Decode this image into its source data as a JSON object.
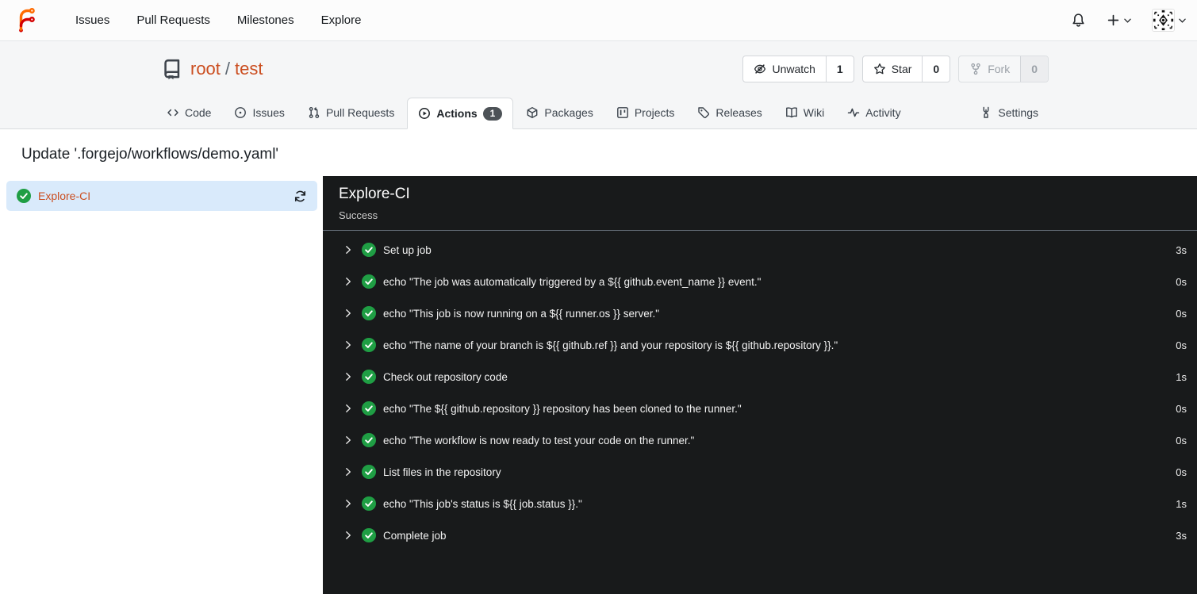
{
  "navbar": {
    "links": [
      "Issues",
      "Pull Requests",
      "Milestones",
      "Explore"
    ],
    "icons": [
      "forgejo-logo",
      "bell-icon",
      "plus-icon",
      "avatar-identicon"
    ]
  },
  "repo_header": {
    "icon": "repo-book-icon",
    "owner": "root",
    "separator": "/",
    "name": "test",
    "buttons": [
      {
        "label": "Unwatch",
        "count": "1",
        "icon": "eye-slash-icon",
        "disabled": false
      },
      {
        "label": "Star",
        "count": "0",
        "icon": "star-icon",
        "disabled": false
      },
      {
        "label": "Fork",
        "count": "0",
        "icon": "git-fork-icon",
        "disabled": true
      }
    ]
  },
  "tabs": [
    {
      "label": "Code",
      "icon": "code-icon"
    },
    {
      "label": "Issues",
      "icon": "issue-circle-icon"
    },
    {
      "label": "Pull Requests",
      "icon": "pull-request-icon"
    },
    {
      "label": "Actions",
      "icon": "play-circle-icon",
      "badge": "1",
      "active": true
    },
    {
      "label": "Packages",
      "icon": "package-icon"
    },
    {
      "label": "Projects",
      "icon": "project-board-icon"
    },
    {
      "label": "Releases",
      "icon": "tag-icon"
    },
    {
      "label": "Wiki",
      "icon": "book-open-icon"
    },
    {
      "label": "Activity",
      "icon": "pulse-icon"
    },
    {
      "label": "Settings",
      "icon": "tools-icon"
    }
  ],
  "page": {
    "title": "Update '.forgejo/workflows/demo.yaml'"
  },
  "jobs_sidebar": {
    "items": [
      {
        "name": "Explore-CI",
        "status": "success",
        "selected": true,
        "trailing_icon": "refresh-icon"
      }
    ]
  },
  "run_panel": {
    "title": "Explore-CI",
    "status_text": "Success",
    "steps": [
      {
        "name": "Set up job",
        "duration": "3s",
        "status": "success"
      },
      {
        "name": "echo \"The job was automatically triggered by a ${{ github.event_name }} event.\"",
        "duration": "0s",
        "status": "success"
      },
      {
        "name": "echo \"This job is now running on a ${{ runner.os }} server.\"",
        "duration": "0s",
        "status": "success"
      },
      {
        "name": "echo \"The name of your branch is ${{ github.ref }} and your repository is ${{ github.repository }}.\"",
        "duration": "0s",
        "status": "success"
      },
      {
        "name": "Check out repository code",
        "duration": "1s",
        "status": "success"
      },
      {
        "name": "echo \"The ${{ github.repository }} repository has been cloned to the runner.\"",
        "duration": "0s",
        "status": "success"
      },
      {
        "name": "echo \"The workflow is now ready to test your code on the runner.\"",
        "duration": "0s",
        "status": "success"
      },
      {
        "name": "List files in the repository",
        "duration": "0s",
        "status": "success"
      },
      {
        "name": "echo \"This job's status is ${{ job.status }}.\"",
        "duration": "1s",
        "status": "success"
      },
      {
        "name": "Complete job",
        "duration": "3s",
        "status": "success"
      }
    ]
  },
  "colors": {
    "accent_orange": "#cb4e20",
    "success_green": "#1f9e44",
    "panel_background": "#181a1b",
    "selected_job_background": "#d9eafb",
    "badge_background": "#4d5257",
    "header_background": "#f5f6f7"
  }
}
